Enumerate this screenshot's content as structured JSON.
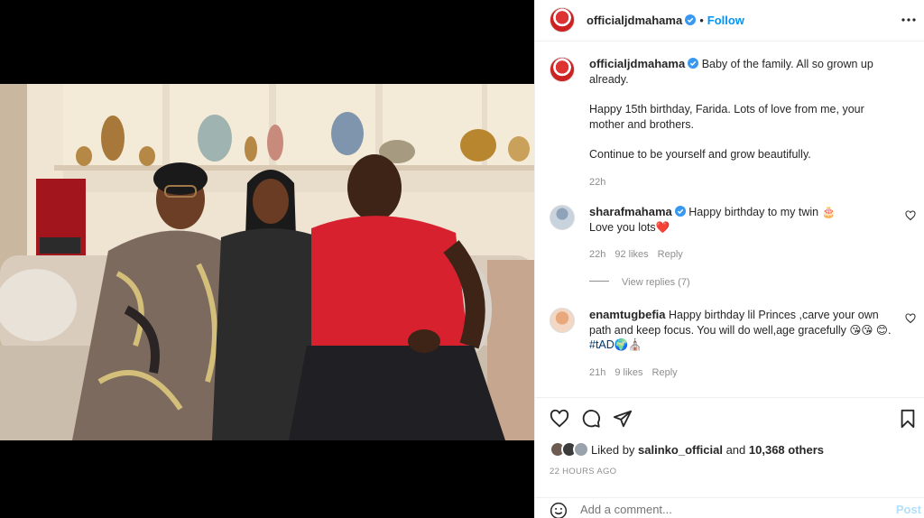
{
  "post": {
    "author": "officialjdmahama",
    "follow_label": "Follow",
    "separator": "•",
    "caption_lines": [
      "Baby of the family. All so grown up already.",
      "Happy 15th birthday, Farida. Lots of love from me, your mother and brothers.",
      "Continue to be yourself and grow beautifully."
    ],
    "caption_time": "22h"
  },
  "comments": [
    {
      "username": "sharafmahama",
      "text_1": "Happy birthday to my twin 🎂",
      "text_2": "Love you lots❤️",
      "time": "22h",
      "likes": "92 likes",
      "reply": "Reply",
      "view_replies": "View replies (7)"
    },
    {
      "username": "enamtugbefia",
      "text": "Happy birthday lil Princes ,carve your own path and keep focus. You will do well,age gracefully 😘😘 😊. ",
      "hashtag": "#tAD",
      "emoji_tail": "🌍⛪",
      "time": "21h",
      "likes": "9 likes",
      "reply": "Reply"
    }
  ],
  "likes": {
    "prefix": "Liked by ",
    "user": "salinko_official",
    "middle": " and ",
    "count": "10,368 others"
  },
  "timestamp": "22 HOURS AGO",
  "add_comment": {
    "placeholder": "Add a comment...",
    "post_label": "Post"
  },
  "colors": {
    "accent": "#0095f6",
    "post_disabled": "#b2dffc",
    "verified": "#3897f0",
    "heart_red": "#ed4956"
  },
  "icons": [
    "more-icon",
    "heart-icon",
    "comment-icon",
    "share-icon",
    "bookmark-icon",
    "emoji-icon",
    "verified-icon"
  ]
}
